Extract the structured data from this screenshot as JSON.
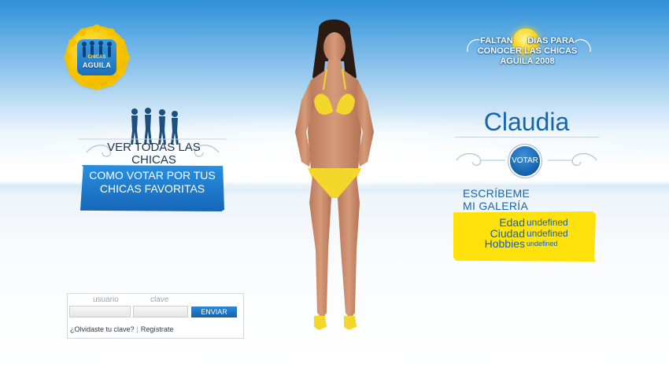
{
  "logo": {
    "line1": "CHICAS",
    "line2": "AGUILA",
    "icon": "aguila-bottle-cap-logo"
  },
  "left": {
    "ver_todas": "VER TODAS LAS CHICAS",
    "como_votar": "COMO VOTAR POR TUS CHICAS FAVORITAS"
  },
  "countdown": {
    "line1": "FALTAN",
    "line1b": "DIAS PARA",
    "line2": "CONOCER LAS CHICAS",
    "line3": "AGUILA 2008"
  },
  "profile": {
    "name": "Claudia",
    "votar": "VOTAR",
    "escribeme": "ESCRÍBEME",
    "galeria": "MI GALERÍA",
    "fields": [
      {
        "label": "Edad",
        "value": "undefined"
      },
      {
        "label": "Ciudad",
        "value": "undefined"
      },
      {
        "label": "Hobbies",
        "value": "undefined"
      }
    ]
  },
  "login": {
    "usuario_label": "usuario",
    "clave_label": "clave",
    "usuario_value": "",
    "clave_value": "",
    "enviar": "ENVIAR",
    "olvidaste": "¿Olvidaste tu clave?",
    "separator": "|",
    "registrate": "Regístrate"
  },
  "colors": {
    "accent_blue": "#1566b0",
    "info_yellow": "#ffe10b",
    "sky_blue": "#2f8fd6"
  }
}
